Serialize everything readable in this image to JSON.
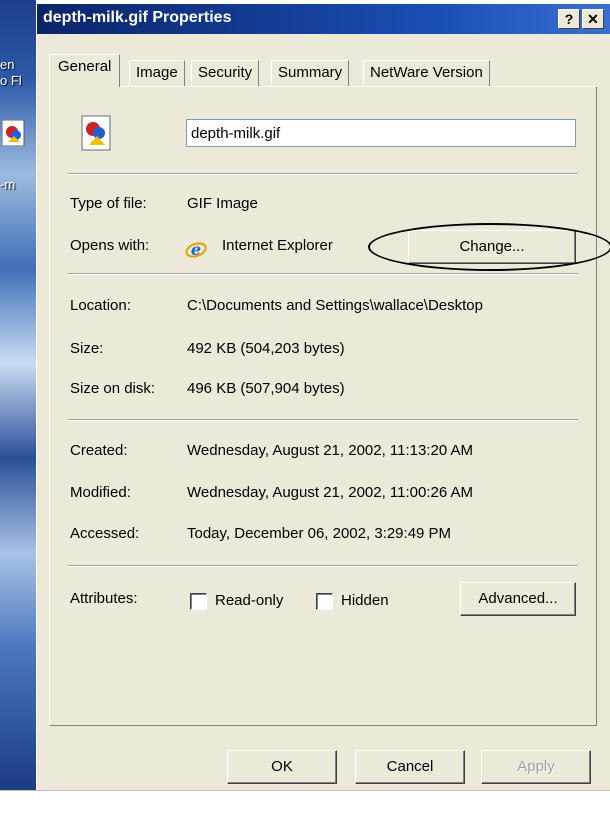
{
  "desktop": {
    "fragments": [
      "en",
      "o Fl",
      "-m"
    ]
  },
  "window": {
    "title": "depth-milk.gif Properties",
    "help_label": "?",
    "close_label": "✕"
  },
  "tabs": [
    {
      "label": "General",
      "active": true
    },
    {
      "label": "Image"
    },
    {
      "label": "Security"
    },
    {
      "label": "Summary"
    },
    {
      "label": "NetWare Version"
    }
  ],
  "general": {
    "filename": "depth-milk.gif",
    "type_label": "Type of file:",
    "type_value": "GIF Image",
    "opens_label": "Opens with:",
    "opens_value": "Internet Explorer",
    "change_label": "Change...",
    "location_label": "Location:",
    "location_value": "C:\\Documents and Settings\\wallace\\Desktop",
    "size_label": "Size:",
    "size_value": "492 KB (504,203 bytes)",
    "disk_label": "Size on disk:",
    "disk_value": "496 KB (507,904 bytes)",
    "created_label": "Created:",
    "created_value": "Wednesday, August 21, 2002, 11:13:20 AM",
    "modified_label": "Modified:",
    "modified_value": "Wednesday, August 21, 2002, 11:00:26 AM",
    "accessed_label": "Accessed:",
    "accessed_value": "Today, December 06, 2002, 3:29:49 PM",
    "attributes_label": "Attributes:",
    "readonly_label": "Read-only",
    "readonly_checked": false,
    "hidden_label": "Hidden",
    "hidden_checked": false,
    "advanced_label": "Advanced..."
  },
  "buttons": {
    "ok": "OK",
    "cancel": "Cancel",
    "apply": "Apply"
  },
  "colors": {
    "titlebar": "#0a246a",
    "dialog_bg": "#ece9d8"
  }
}
